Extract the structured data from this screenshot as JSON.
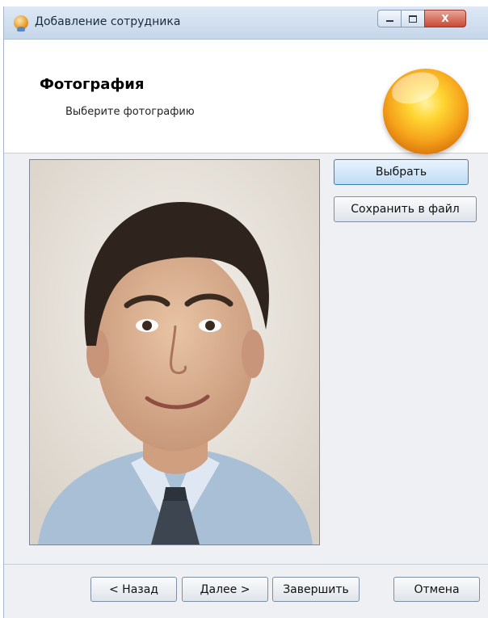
{
  "window": {
    "title": "Добавление сотрудника",
    "close_symbol": "X"
  },
  "header": {
    "title": "Фотография",
    "subtitle": "Выберите фотографию"
  },
  "side_buttons": {
    "choose": "Выбрать",
    "save_to_file": "Сохранить в файл"
  },
  "footer": {
    "back": "< Назад",
    "next": "Далее >",
    "finish": "Завершить",
    "cancel": "Отмена"
  },
  "icons": {
    "app": "employee-icon",
    "wizard": "orange-orb-icon"
  },
  "colors": {
    "accent_button": "#bfdcf5",
    "close_button": "#c84a33",
    "orb": "#f6a51c"
  }
}
